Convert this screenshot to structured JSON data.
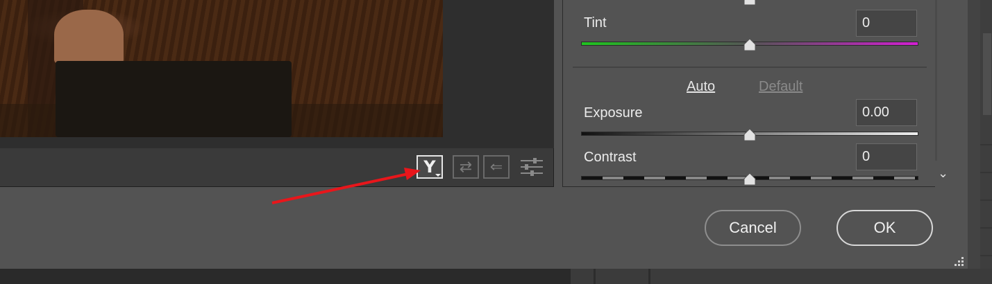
{
  "panel": {
    "tint": {
      "label": "Tint",
      "value": "0",
      "level": 0.5
    },
    "temperature": {
      "level": 0.5
    },
    "auto_label": "Auto",
    "default_label": "Default",
    "exposure": {
      "label": "Exposure",
      "value": "0.00",
      "level": 0.5
    },
    "contrast": {
      "label": "Contrast",
      "value": "0",
      "level": 0.5
    }
  },
  "toolbar": {
    "cycle_glyph": "Y",
    "swap_glyph": "⇄",
    "copy_glyph": "⇐",
    "prefs_glyph": "☰"
  },
  "buttons": {
    "cancel_label": "Cancel",
    "ok_label": "OK"
  },
  "annotation": {
    "color": "#e8161b"
  },
  "panel_scroll": {
    "chevron": "⌄"
  }
}
